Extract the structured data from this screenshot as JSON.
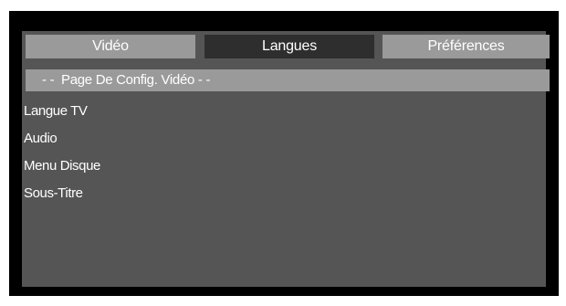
{
  "tabs": [
    {
      "label": "Vidéo",
      "state": "inactive"
    },
    {
      "label": "Langues",
      "state": "active"
    },
    {
      "label": "Préférences",
      "state": "inactive"
    }
  ],
  "section_header": "- -  Page De Config. Vidéo - -",
  "menu": {
    "items": [
      {
        "label": "Langue TV"
      },
      {
        "label": "Audio"
      },
      {
        "label": "Menu Disque"
      },
      {
        "label": "Sous-Titre"
      }
    ]
  },
  "colors": {
    "frame": "#000000",
    "panel": "#555555",
    "tab_inactive": "#9a9a9a",
    "tab_active": "#2e2e2e",
    "text": "#ffffff"
  }
}
